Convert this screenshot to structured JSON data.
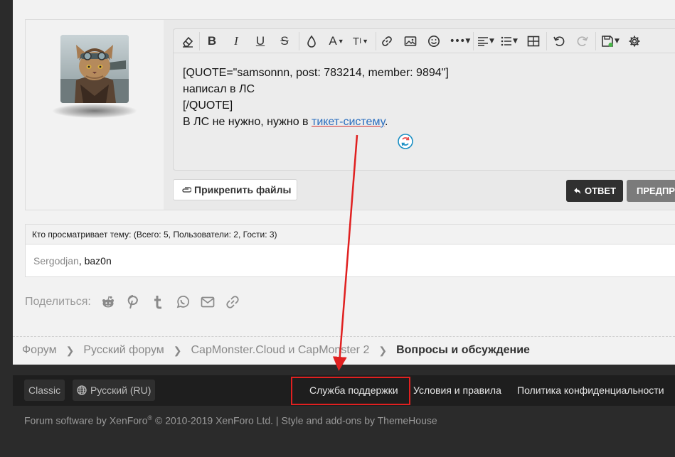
{
  "editor": {
    "lines": [
      "[QUOTE=\"samsonnn, post: 783214, member: 9894\"]",
      "написал в ЛС",
      "[/QUOTE]"
    ],
    "last_line_prefix": "В ЛС не нужно, нужно в ",
    "link_text": "тикет-систему",
    "last_line_suffix": "."
  },
  "actions": {
    "attach_label": "Прикрепить файлы",
    "reply_label": "ОТВЕТ",
    "preview_label": "ПРЕДПРОСМОТР"
  },
  "viewers": {
    "header": "Кто просматривает тему: (Всего: 5, Пользователи: 2, Гости: 3)",
    "users": [
      "Sergodjan",
      "baz0n"
    ]
  },
  "share": {
    "label": "Поделиться:"
  },
  "breadcrumb": {
    "items": [
      "Форум",
      "Русский форум",
      "CapMonster.Cloud и CapMonster 2"
    ],
    "current": "Вопросы и обсуждение"
  },
  "footer": {
    "style_chooser": "Classic",
    "language": "Русский (RU)",
    "links": [
      "Служба поддержки",
      "Условия и правила",
      "Политика конфиденциальности"
    ],
    "copyright_software": "Forum software by XenForo",
    "copyright_mark": "®",
    "copyright_rest": " © 2010-2019 XenForo Ltd. | Style and add-ons by ThemeHouse"
  },
  "colors": {
    "annotation": "#e02020",
    "link": "#2a6ebf"
  }
}
